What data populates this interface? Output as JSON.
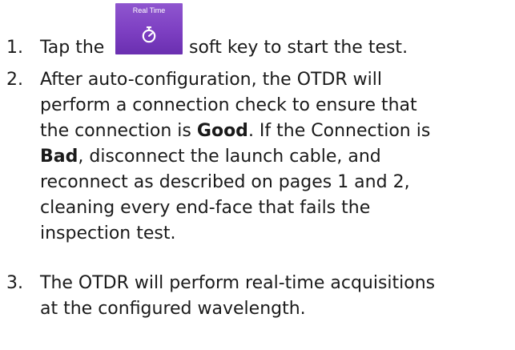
{
  "steps": [
    {
      "number": "1.",
      "pre": "Tap the",
      "softkey_label": "Real Time",
      "softkey_icon": "stopwatch-icon",
      "post": "soft key to start the test."
    },
    {
      "number": "2.",
      "lines": [
        "After auto-configuration, the OTDR will",
        "perform a connection check to ensure that",
        "the connection is",
        "Good",
        ". If the Connection is",
        "Bad",
        ", disconnect the launch cable, and",
        "reconnect as described on pages 1 and 2,",
        "cleaning every end-face that fails the",
        "inspection test."
      ]
    },
    {
      "number": "3.",
      "lines": [
        "The OTDR will perform real-time acquisitions",
        "at the configured wavelength."
      ]
    }
  ],
  "colors": {
    "softkey_bg": "#7d3fc2",
    "text": "#1a1a1a"
  }
}
